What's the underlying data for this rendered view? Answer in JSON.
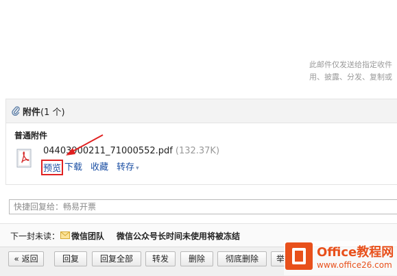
{
  "notice": {
    "line1": "此邮件仅发送给指定收件",
    "line2": "用、披露、分发、复制或"
  },
  "attachments": {
    "title": "附件",
    "count": "(1 个)",
    "section_label": "普通附件",
    "file": {
      "name": "04403900211_71000552.pdf",
      "size": "(132.37K)",
      "icon": "pdf-icon"
    },
    "actions": {
      "preview": "预览",
      "download": "下载",
      "favorite": "收藏",
      "save_to": "转存",
      "save_to_caret": "▾"
    }
  },
  "quick_reply": {
    "placeholder": "快捷回复给：畅易开票"
  },
  "next_unread": {
    "label": "下一封未读：",
    "sender": "微信团队",
    "subject": "微信公众号长时间未使用将被冻结"
  },
  "toolbar": {
    "back": "« 返回",
    "reply": "回复",
    "reply_all": "回复全部",
    "forward": "转发",
    "delete": "删除",
    "delete_permanently": "彻底删除",
    "report": "举报"
  },
  "watermark": {
    "title": "Office教程网",
    "url": "www.office26.com"
  },
  "colors": {
    "link": "#1a4ea3",
    "highlight": "#e02020",
    "watermark": "#e8501b"
  }
}
